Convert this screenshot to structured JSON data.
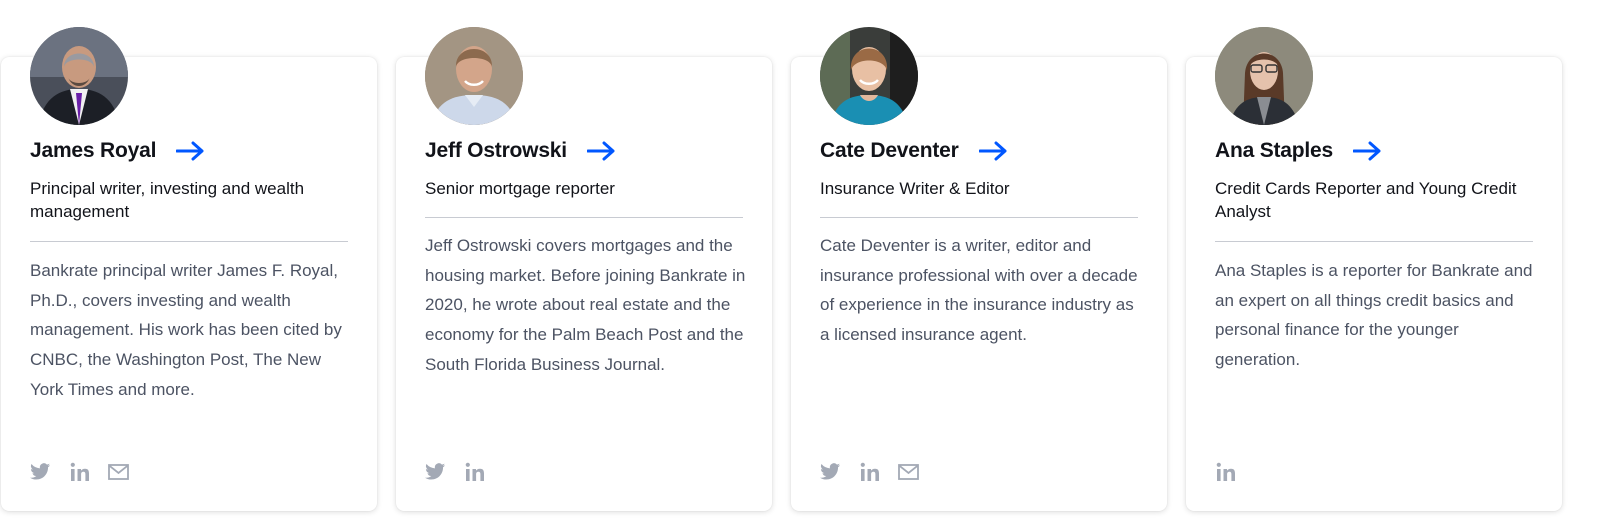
{
  "colors": {
    "accent": "#0157ff",
    "name": "#111319",
    "bio": "#4c5363",
    "icon": "#a3a9b5",
    "divider": "#c8cbd2"
  },
  "authors": [
    {
      "name": "James Royal",
      "role": "Principal writer, investing and wealth management",
      "bio": "Bankrate principal writer James F. Royal, Ph.D., covers investing and wealth management. His work has been cited by CNBC, the Washington Post, The New York Times and more.",
      "socials": [
        "twitter-icon",
        "linkedin-icon",
        "email-icon"
      ]
    },
    {
      "name": "Jeff Ostrowski",
      "role": "Senior mortgage reporter",
      "bio": "Jeff Ostrowski covers mortgages and the housing market. Before joining Bankrate in 2020, he wrote about real estate and the economy for the Palm Beach Post and the South Florida Business Journal.",
      "socials": [
        "twitter-icon",
        "linkedin-icon"
      ]
    },
    {
      "name": "Cate Deventer",
      "role": "Insurance Writer & Editor",
      "bio": "Cate Deventer is a writer, editor and insurance professional with over a decade of experience in the insurance industry as a licensed insurance agent.",
      "socials": [
        "twitter-icon",
        "linkedin-icon",
        "email-icon"
      ]
    },
    {
      "name": "Ana Staples",
      "role": "Credit Cards Reporter and Young Credit Analyst",
      "bio": "Ana Staples is a reporter for Bankrate and an expert on all things credit basics and personal finance for the younger generation.",
      "socials": [
        "linkedin-icon"
      ]
    }
  ]
}
